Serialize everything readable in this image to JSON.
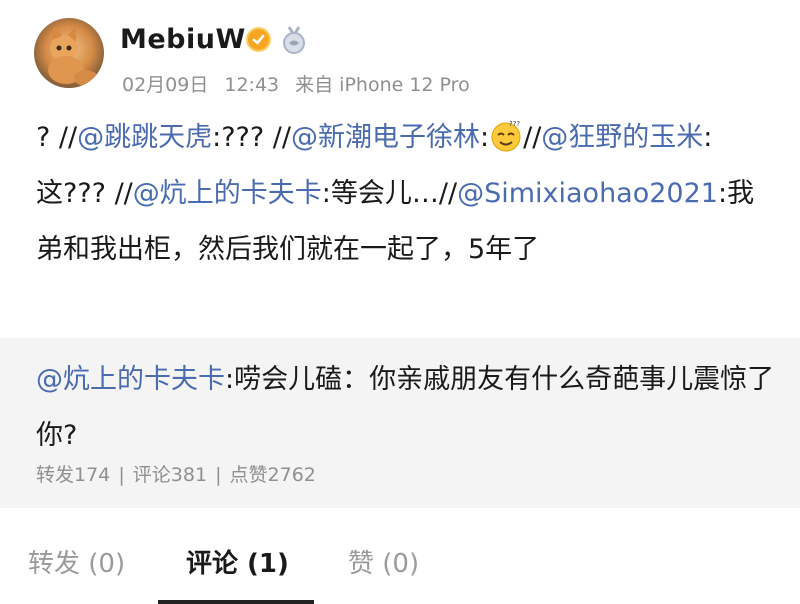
{
  "author": {
    "name": "MebiuW",
    "avatar_icon": "cat-avatar",
    "verified_icon": "verified-icon",
    "medal_icon": "medal-icon"
  },
  "meta": {
    "date": "02月09日",
    "time": "12:43",
    "source": "来自 iPhone 12 Pro"
  },
  "post": {
    "p1": "? //",
    "m1": "@跳跳天虎",
    "p2": ":??? //",
    "m2": "@新潮电子徐林",
    "p3": ":",
    "emoji_icon": "dizzy-face-emoji",
    "p4": "//",
    "m3": "@狂野的玉米",
    "p5": ": 这??? //",
    "m4": "@炕上的卡夫卡",
    "p6": ":等会儿…//",
    "m5": "@Simixiaohao2021",
    "p7": ":我弟和我出柜，然后我们就在一起了，5年了"
  },
  "repost": {
    "mention": "@炕上的卡夫卡",
    "text": ":唠会儿磕：你亲戚朋友有什么奇葩事儿震惊了你?",
    "stats": {
      "forward": "转发174",
      "comment": "评论381",
      "like": "点赞2762",
      "sep": "|"
    }
  },
  "tabs": {
    "forward": "转发 (0)",
    "comment": "评论 (1)",
    "like": "赞 (0)"
  },
  "colors": {
    "link": "#4b6bb0",
    "meta": "#8f8f8f",
    "repost_bg": "#f4f4f4",
    "verify": "#f6a623"
  }
}
